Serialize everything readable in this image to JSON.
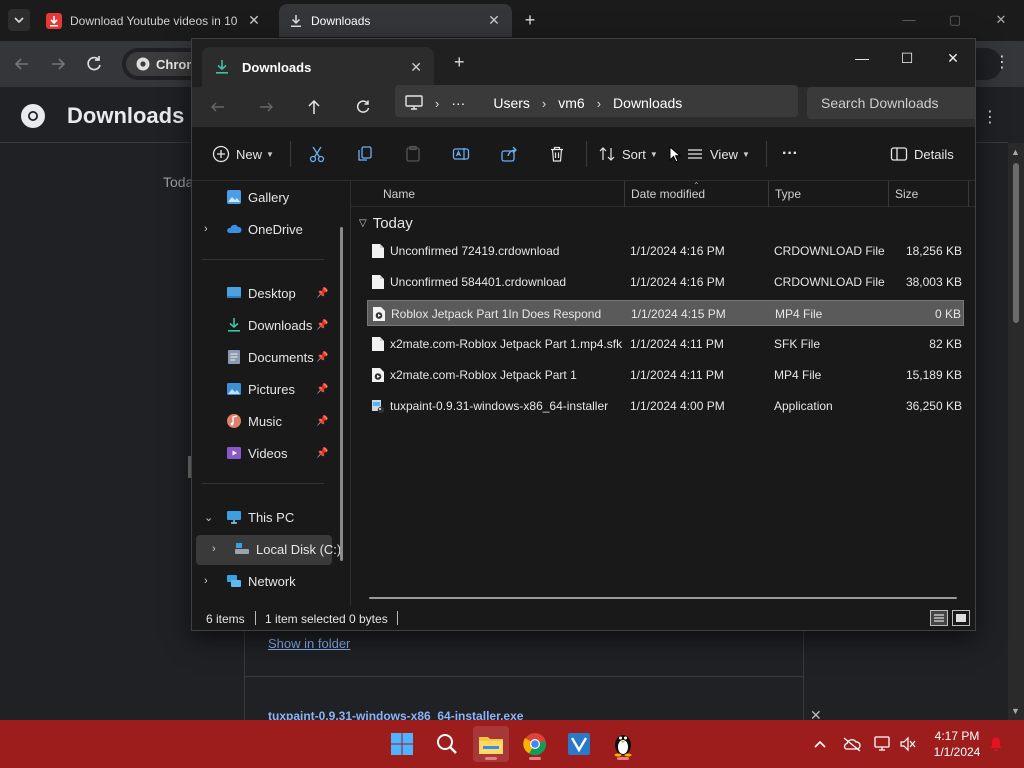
{
  "chrome": {
    "tabs": [
      {
        "title": "Download Youtube videos in 10",
        "close": "✕"
      },
      {
        "title": "Downloads",
        "close": "✕"
      }
    ],
    "new_tab": "+",
    "chip_label": "Chrome",
    "page_title": "Downloads",
    "section_label": "Toda",
    "show_in_folder": "Show in folder",
    "file_link": "tuxpaint-0.9.31-windows-x86_64-installer.exe",
    "file_close": "✕",
    "window_controls": {
      "minimize": "—",
      "maximize": "▢",
      "close": "✕"
    }
  },
  "explorer": {
    "tab_title": "Downloads",
    "tab_close": "✕",
    "new_tab": "+",
    "window_controls": {
      "minimize": "—",
      "maximize": "☐",
      "close": "✕"
    },
    "breadcrumb": {
      "more": "···",
      "items": [
        "Users",
        "vm6",
        "Downloads"
      ],
      "sep": "›"
    },
    "search_placeholder": "Search Downloads",
    "toolbar": {
      "new_label": "New",
      "sort_label": "Sort",
      "view_label": "View",
      "more_label": "···",
      "details_label": "Details"
    },
    "nav": {
      "gallery": "Gallery",
      "onedrive": "OneDrive",
      "quick_access": [
        {
          "label": "Desktop",
          "icon": "desktop-icon"
        },
        {
          "label": "Downloads",
          "icon": "downloads-icon"
        },
        {
          "label": "Documents",
          "icon": "documents-icon"
        },
        {
          "label": "Pictures",
          "icon": "pictures-icon"
        },
        {
          "label": "Music",
          "icon": "music-icon"
        },
        {
          "label": "Videos",
          "icon": "videos-icon"
        }
      ],
      "this_pc": "This PC",
      "local_disk": "Local Disk (C:)",
      "network": "Network"
    },
    "columns": {
      "name": "Name",
      "date": "Date modified",
      "type": "Type",
      "size": "Size"
    },
    "group_label": "Today",
    "files": [
      {
        "name": "Unconfirmed 72419.crdownload",
        "date": "1/1/2024 4:16 PM",
        "type": "CRDOWNLOAD File",
        "size": "18,256 KB",
        "icon": "blank-file-icon",
        "selected": false
      },
      {
        "name": "Unconfirmed 584401.crdownload",
        "date": "1/1/2024 4:16 PM",
        "type": "CRDOWNLOAD File",
        "size": "38,003 KB",
        "icon": "blank-file-icon",
        "selected": false
      },
      {
        "name": "Roblox Jetpack Part 1In Does Respond",
        "date": "1/1/2024 4:15 PM",
        "type": "MP4 File",
        "size": "0 KB",
        "icon": "video-file-icon",
        "selected": true
      },
      {
        "name": "x2mate.com-Roblox Jetpack Part 1.mp4.sfk",
        "date": "1/1/2024 4:11 PM",
        "type": "SFK File",
        "size": "82 KB",
        "icon": "blank-file-icon",
        "selected": false
      },
      {
        "name": "x2mate.com-Roblox Jetpack Part 1",
        "date": "1/1/2024 4:11 PM",
        "type": "MP4 File",
        "size": "15,189 KB",
        "icon": "video-file-icon",
        "selected": false
      },
      {
        "name": "tuxpaint-0.9.31-windows-x86_64-installer",
        "date": "1/1/2024 4:00 PM",
        "type": "Application",
        "size": "36,250 KB",
        "icon": "installer-icon",
        "selected": false
      }
    ],
    "status": {
      "count": "6 items",
      "selected": "1 item selected",
      "bytes": "0 bytes"
    }
  },
  "taskbar": {
    "time": "4:17 PM",
    "date": "1/1/2024"
  },
  "colors": {
    "taskbar": "#9d1d1d",
    "link": "#8ab4f8",
    "selection": "#5a5a5a",
    "notification": "#e81123"
  }
}
